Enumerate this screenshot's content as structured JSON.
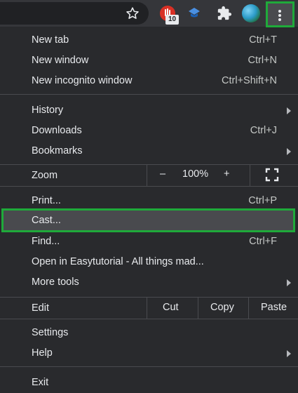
{
  "toolbar": {
    "extension_badge": "10",
    "icons": [
      "star-icon",
      "red-extension-icon",
      "blue-extension-icon",
      "puzzle-icon",
      "profile-avatar",
      "more-vert-icon"
    ]
  },
  "menu": {
    "new_tab": {
      "label": "New tab",
      "shortcut": "Ctrl+T"
    },
    "new_window": {
      "label": "New window",
      "shortcut": "Ctrl+N"
    },
    "new_incognito": {
      "label": "New incognito window",
      "shortcut": "Ctrl+Shift+N"
    },
    "history": {
      "label": "History"
    },
    "downloads": {
      "label": "Downloads",
      "shortcut": "Ctrl+J"
    },
    "bookmarks": {
      "label": "Bookmarks"
    },
    "zoom": {
      "label": "Zoom",
      "minus": "–",
      "value": "100%",
      "plus": "+"
    },
    "print": {
      "label": "Print...",
      "shortcut": "Ctrl+P"
    },
    "cast": {
      "label": "Cast..."
    },
    "find": {
      "label": "Find...",
      "shortcut": "Ctrl+F"
    },
    "open_in": {
      "label": "Open in Easytutorial - All things mad..."
    },
    "more_tools": {
      "label": "More tools"
    },
    "edit": {
      "label": "Edit",
      "cut": "Cut",
      "copy": "Copy",
      "paste": "Paste"
    },
    "settings": {
      "label": "Settings"
    },
    "help": {
      "label": "Help"
    },
    "exit": {
      "label": "Exit"
    }
  },
  "colors": {
    "background": "#292a2d",
    "highlight_border": "#1faa3a",
    "text": "#e8eaed"
  }
}
